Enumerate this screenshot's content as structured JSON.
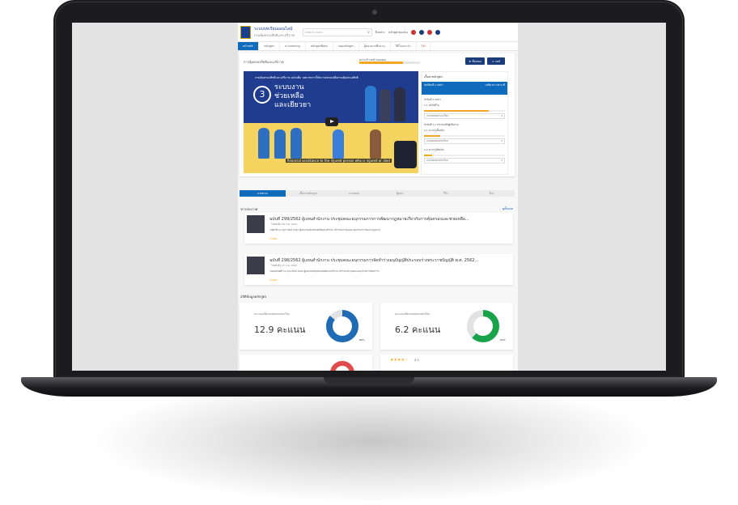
{
  "header": {
    "brand": "ระบบบทเรียนออนไลน์",
    "brand_sub": "กรมคุ้มครองสิทธิและเสรีภาพ",
    "search_placeholder": "Search topic",
    "links": [
      "ปีงบประ",
      "หลักสูตรของฉัน"
    ],
    "language": "TH"
  },
  "nav": {
    "tabs": [
      "หน้าหลัก",
      "หลักสูตร",
      "e-Learning",
      "หลักสูตรพิเศษ",
      "กลุ่มหลักสูตร",
      "ผู้สอนจากทีมงาน",
      "วีดีโอแนะนำ",
      "ติดต่อเรา"
    ]
  },
  "course": {
    "title": "การคุ้มครองสิทธิและเสรีภาพ",
    "progress_label": "ความก้าวหน้าของคุณ",
    "progress": 0.72,
    "btn_like": "ชื่นชอบ",
    "btn_share": "แชร์",
    "video_title": "กรมคุ้มครองสิทธิและเสรีภาพ ฉบับเต็ม บทบาทการให้ความช่วยเหลือกรมคุ้มครองสิทธิ",
    "video_number": "3",
    "video_headline": [
      "ระบบงาน",
      "ช่วยเหลือ",
      "และเยียวยา"
    ],
    "subtitle": "financial assistance to the injured person who is injured or died"
  },
  "sidebar": {
    "heading": "เนื้อหาหลักสูตร",
    "active_title": "บทเรียนที่ 1 บทนำ",
    "active_duration": "เหลือเวลา 28 นาที",
    "groups": [
      {
        "label": "หัวข้อที่ 1 บทนำ",
        "item": "1.1 คลิปวิดีโอ",
        "progress": 0.8,
        "select": "แบบทดสอบก่อนเรียน"
      },
      {
        "label": "หัวข้อที่ 2 การช่วยเหลือผู้เสียหาย",
        "item": "2.1 ความรู้เบื้องต้น",
        "progress": 0.2,
        "select": "แบบทดสอบหลังเรียน"
      },
      {
        "label": "",
        "item": "2.2 ความรู้เพิ่มเติม",
        "progress": 0.1,
        "select": "แบบทดสอบหลังเรียน"
      }
    ]
  },
  "tabs": [
    "ภาพรวม",
    "เนื้อหาหลักสูตร",
    "ถามตอบ",
    "ผู้สอน",
    "รีวิว",
    "อื่นๆ"
  ],
  "news": {
    "heading": "ข่าวประกาศ",
    "see_all": "ดูทั้งหมด",
    "items": [
      {
        "title": "ฉบับที่ 299/2562 ผู้แทนสำนักงาน ประชุมคณะอนุกรรมการการพัฒนากฎหมายเกี่ยวกับการคุ้มครองและช่วยเหลือ...",
        "meta": "โพสต์เมื่อ 28 ก.พ. 2562",
        "desc": "วันศุกร์ที่ 22 กุมภาพันธ์ 2562 ผู้แทนกรมคุ้มครองสิทธิและเสรีภาพ เข้าร่วมประชุมคณะอนุกรรมการพัฒนากฎหมาย",
        "foot": "อ่านต่อ"
      },
      {
        "title": "ฉบับที่ 298/2562 ผู้แทนสำนักงาน ประชุมคณะอนุกรรมการจัดทำร่างอนุบัญญัติประกอบร่างพระราชบัญญัติ พ.ศ. 2562...",
        "meta": "โพสต์เมื่อ 27 ก.พ. 2562",
        "desc": "วันพฤหัสบดีที่ 21 กุมภาพันธ์ 2562 ผู้แทนกรมคุ้มครองสิทธิและเสรีภาพ เข้าร่วมประชุมคณะอนุกรรมการจัดทำร่าง",
        "foot": "อ่านต่อ"
      }
    ]
  },
  "stats": {
    "heading": "สถิติข้อมูลหลักสูตร",
    "cards": [
      {
        "label": "คะแนนเฉลี่ยแบบทดสอบก่อนเรียน",
        "value": "12.9 คะแนน",
        "pct": "86%",
        "fraction": 0.86,
        "color": "#1f6cb5"
      },
      {
        "label": "คะแนนเฉลี่ยแบบทดสอบหลังเรียน",
        "value": "6.2 คะแนน",
        "pct": "62%",
        "fraction": 0.62,
        "color": "#19a34a"
      }
    ],
    "rating_text": "4.5"
  }
}
